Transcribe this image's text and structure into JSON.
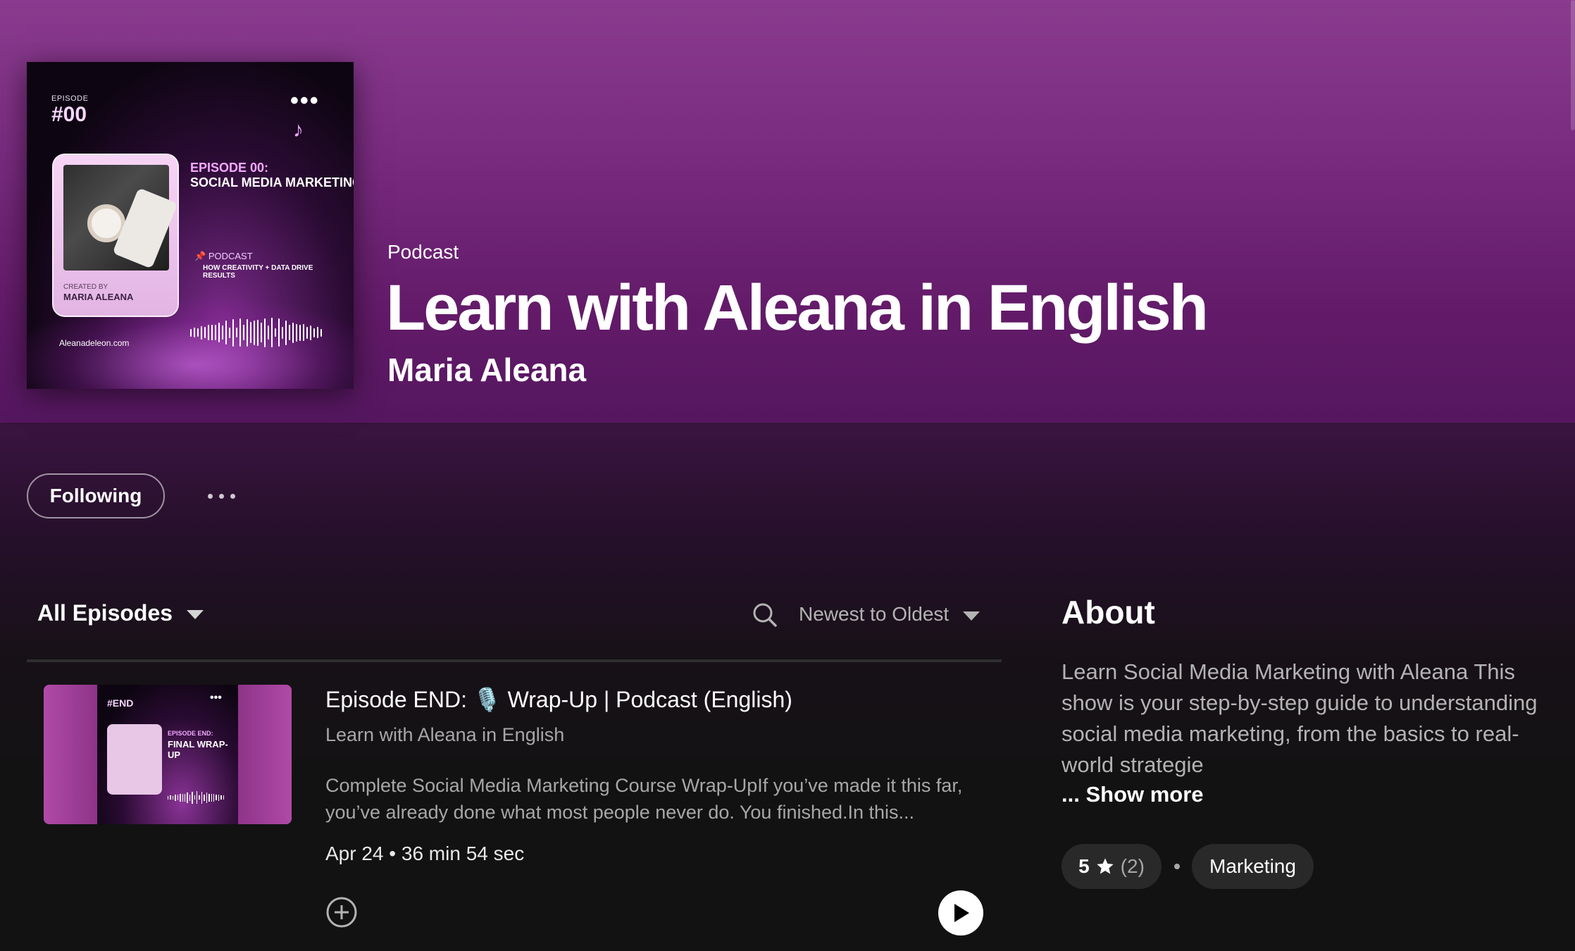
{
  "header": {
    "kind_label": "Podcast",
    "title": "Learn with Aleana in English",
    "author": "Maria Aleana"
  },
  "cover_art": {
    "episode_small": "EPISODE",
    "episode_number": "#00",
    "episode_title_line1": "EPISODE 00:",
    "episode_title_rest": "SOCIAL MEDIA MARKETING FOR BEGINNERS",
    "podcast_tag": "PODCAST",
    "tagline": "HOW CREATIVITY + DATA DRIVE RESULTS",
    "created_by_small": "CREATED BY",
    "created_by_name": "MARIA ALEANA",
    "website": "Aleanadeleon.com"
  },
  "actions": {
    "follow_label": "Following",
    "more_options_icon": "ellipsis-icon"
  },
  "episodes_toolbar": {
    "filter_label": "All Episodes",
    "search_icon": "search-icon",
    "sort_label": "Newest to Oldest"
  },
  "episodes": [
    {
      "thumb_episode": "#END",
      "thumb_title_small": "EPISODE END:",
      "thumb_title": "FINAL WRAP-UP",
      "title": "Episode END: 🎙️ Wrap-Up | Podcast (English)",
      "show": "Learn with Aleana in English",
      "description": "Complete Social Media Marketing Course Wrap-UpIf you’ve made it this far, you’ve already done what most people never do. You finished.In this...",
      "date": "Apr 24",
      "duration": "36 min 54 sec",
      "add_icon": "plus-circle-icon",
      "play_icon": "play-icon"
    }
  ],
  "about": {
    "heading": "About",
    "text": "Learn Social Media Marketing with Aleana This show is your step-by-step guide to understanding social media marketing, from the basics to real-world strategie",
    "show_more": "... Show more",
    "rating_value": "5",
    "rating_count": "(2)",
    "category": "Marketing"
  },
  "colors": {
    "hero_top": "#8a3b8e",
    "hero_bottom": "#551760",
    "background": "#121212",
    "pill_bg": "#292929",
    "muted_text": "#a7a7a7"
  }
}
